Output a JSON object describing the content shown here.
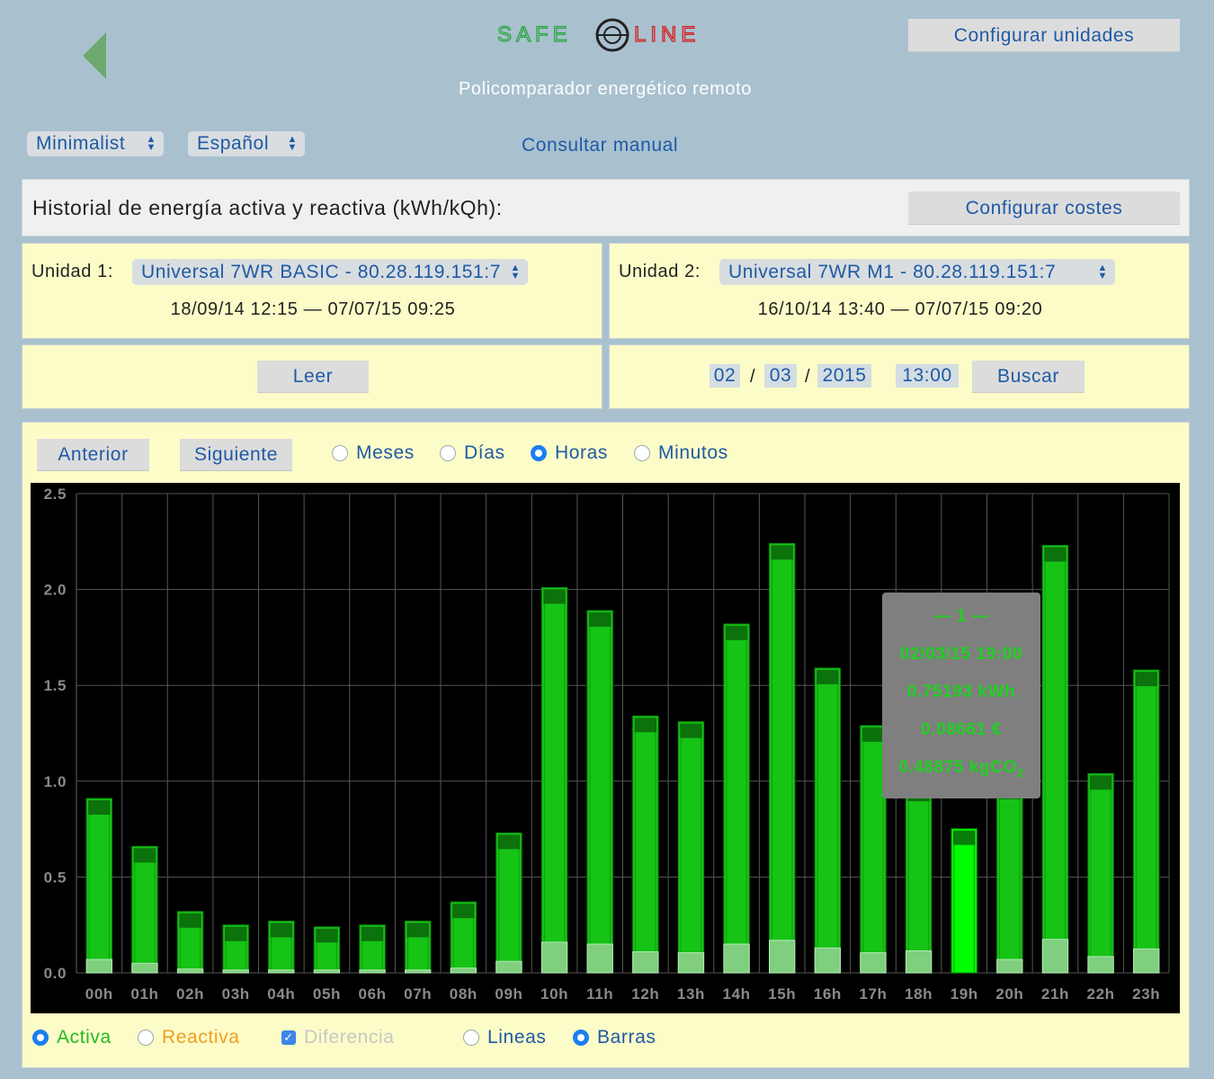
{
  "header": {
    "logo_text": "SAFE LINE",
    "subtitle": "Policomparador energético remoto",
    "config_units_label": "Configurar unidades",
    "theme_select": "Minimalist",
    "language_select": "Español",
    "manual_link": "Consultar manual"
  },
  "history": {
    "title": "Historial de energía activa y reactiva (kWh/kQh):",
    "config_costs_label": "Configurar costes"
  },
  "unit1": {
    "label": "Unidad 1:",
    "select": "Universal 7WR BASIC - 80.28.119.151:7",
    "range": "18/09/14 12:15 — 07/07/15 09:25",
    "read_label": "Leer"
  },
  "unit2": {
    "label": "Unidad 2:",
    "select": "Universal 7WR M1 - 80.28.119.151:7",
    "range": "16/10/14 13:40 — 07/07/15 09:20",
    "day": "02",
    "month": "03",
    "year": "2015",
    "sep1": "/",
    "sep2": "/",
    "time": "13:00",
    "search_label": "Buscar"
  },
  "nav": {
    "prev_label": "Anterior",
    "next_label": "Siguiente",
    "modes": [
      "Meses",
      "Días",
      "Horas",
      "Minutos"
    ],
    "selected_mode": "Horas"
  },
  "legend": {
    "active_label": "Activa",
    "reactive_label": "Reactiva",
    "diff_label": "Diferencia",
    "lines_label": "Lineas",
    "bars_label": "Barras"
  },
  "tooltip": {
    "unit": "— 1 —",
    "datetime": "02/03/15 19:00",
    "energy": "0.75193 kWh",
    "cost": "0.08661 €",
    "co2": "0.48875 kgCO",
    "co2_sub": "2"
  },
  "colors": {
    "background": "#a9c1cf",
    "panel": "#fcfcc8",
    "link": "#1f5aa6",
    "bar": "#16c416",
    "bar_highlight": "#00ff00",
    "active": "#22bb22",
    "reactive": "#f0a020"
  },
  "chart_data": {
    "type": "bar",
    "categories": [
      "00h",
      "01h",
      "02h",
      "03h",
      "04h",
      "05h",
      "06h",
      "07h",
      "08h",
      "09h",
      "10h",
      "11h",
      "12h",
      "13h",
      "14h",
      "15h",
      "16h",
      "17h",
      "18h",
      "19h",
      "20h",
      "21h",
      "22h",
      "23h"
    ],
    "values": [
      0.91,
      0.66,
      0.32,
      0.25,
      0.27,
      0.24,
      0.25,
      0.27,
      0.37,
      0.73,
      2.01,
      1.89,
      1.34,
      1.31,
      1.82,
      2.24,
      1.59,
      1.29,
      0.98,
      0.75193,
      0.99,
      2.23,
      1.04,
      1.58
    ],
    "base_values": [
      0.07,
      0.05,
      0.02,
      0.015,
      0.015,
      0.015,
      0.015,
      0.015,
      0.025,
      0.06,
      0.16,
      0.15,
      0.11,
      0.105,
      0.15,
      0.17,
      0.13,
      0.105,
      0.115,
      0.0,
      0.07,
      0.175,
      0.085,
      0.125
    ],
    "highlight_index": 19,
    "yticks": [
      "0.0",
      "0.5",
      "1.0",
      "1.5",
      "2.0",
      "2.5"
    ],
    "ylim": [
      0,
      2.5
    ],
    "grid": true
  }
}
